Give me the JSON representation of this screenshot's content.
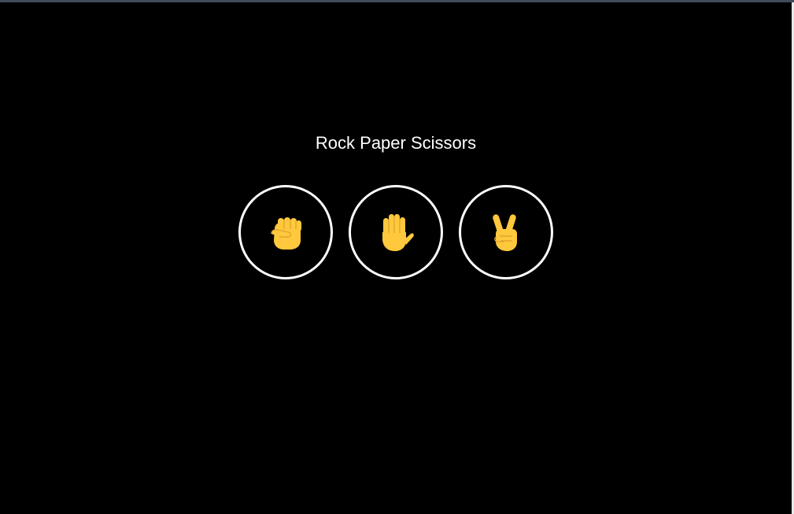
{
  "game": {
    "title": "Rock Paper Scissors",
    "choices": [
      {
        "name": "rock",
        "icon": "raised-fist-icon"
      },
      {
        "name": "paper",
        "icon": "raised-hand-icon"
      },
      {
        "name": "scissors",
        "icon": "victory-hand-icon"
      }
    ]
  },
  "colors": {
    "background": "#000000",
    "title_text": "#ffffff",
    "circle_border": "#ffffff",
    "hand_fill": "#ffc83d",
    "hand_shade": "#e2a52b"
  }
}
